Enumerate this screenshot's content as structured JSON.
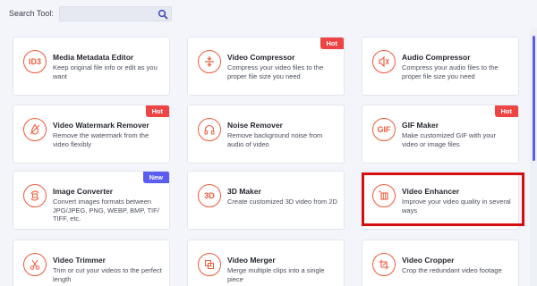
{
  "search": {
    "label": "Search Tool:",
    "value": "",
    "placeholder": ""
  },
  "tools": [
    {
      "title": "Media Metadata Editor",
      "desc": "Keep original file info or edit as you want",
      "icon": "id3-icon",
      "badge": ""
    },
    {
      "title": "Video Compressor",
      "desc": "Compress your video files to the proper file size you need",
      "icon": "compress-icon",
      "badge": "Hot"
    },
    {
      "title": "Audio Compressor",
      "desc": "Compress your audio files to the proper file size you need",
      "icon": "audio-compress-icon",
      "badge": ""
    },
    {
      "title": "Video Watermark Remover",
      "desc": "Remove the watermark from the video flexibly",
      "icon": "watermark-remove-icon",
      "badge": "Hot"
    },
    {
      "title": "Noise Remover",
      "desc": "Remove background noise from audio of video",
      "icon": "headphones-icon",
      "badge": ""
    },
    {
      "title": "GIF Maker",
      "desc": "Make customized GIF with your video or image files",
      "icon": "gif-icon",
      "badge": "Hot"
    },
    {
      "title": "Image Converter",
      "desc": "Convert images formats between JPG/JPEG, PNG, WEBP, BMP, TIF/ TIFF, etc.",
      "icon": "image-convert-icon",
      "badge": "New"
    },
    {
      "title": "3D Maker",
      "desc": "Create customized 3D video from 2D",
      "icon": "3d-icon",
      "badge": ""
    },
    {
      "title": "Video Enhancer",
      "desc": "Improve your video quality in several ways",
      "icon": "enhance-icon",
      "badge": ""
    },
    {
      "title": "Video Trimmer",
      "desc": "Trim or cut your videos to the perfect length",
      "icon": "scissors-icon",
      "badge": ""
    },
    {
      "title": "Video Merger",
      "desc": "Merge multiple clips into a single piece",
      "icon": "merge-icon",
      "badge": ""
    },
    {
      "title": "Video Cropper",
      "desc": "Crop the redundant video footage",
      "icon": "crop-icon",
      "badge": ""
    }
  ],
  "icon_texts": {
    "id3": "ID3",
    "gif": "GIF",
    "three_d": "3D"
  },
  "colors": {
    "accent": "#ef5a3a",
    "hot": "#ef4444",
    "new": "#5b5cf0",
    "highlight": "#d40f0f",
    "scrollbar": "#5c5ee3"
  }
}
